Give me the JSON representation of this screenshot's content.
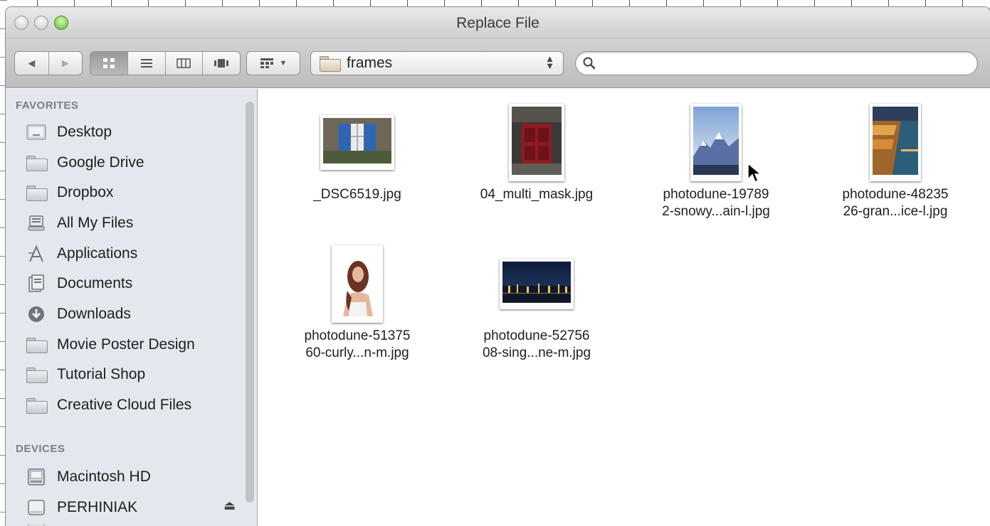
{
  "window": {
    "title": "Replace File"
  },
  "toolbar": {
    "back_icon": "◀",
    "forward_icon": "▶",
    "view_modes": [
      "icon-view",
      "list-view",
      "column-view",
      "cover-flow-view"
    ],
    "active_view": "icon-view",
    "arrange_icon": "arrange-icon",
    "path_folder": "frames",
    "search_placeholder": ""
  },
  "sidebar": {
    "favorites_header": "FAVORITES",
    "favorites": [
      {
        "label": "Desktop",
        "icon": "desktop-icon"
      },
      {
        "label": "Google Drive",
        "icon": "folder-icon"
      },
      {
        "label": "Dropbox",
        "icon": "folder-icon"
      },
      {
        "label": "All My Files",
        "icon": "all-files-icon"
      },
      {
        "label": "Applications",
        "icon": "applications-icon"
      },
      {
        "label": "Documents",
        "icon": "documents-icon"
      },
      {
        "label": "Downloads",
        "icon": "downloads-icon"
      },
      {
        "label": "Movie Poster Design",
        "icon": "folder-icon"
      },
      {
        "label": "Tutorial Shop",
        "icon": "folder-icon"
      },
      {
        "label": "Creative Cloud Files",
        "icon": "folder-icon"
      }
    ],
    "devices_header": "DEVICES",
    "devices": [
      {
        "label": "Macintosh HD",
        "icon": "hard-drive-icon",
        "eject": false
      },
      {
        "label": "PERHINIAK",
        "icon": "external-drive-icon",
        "eject": true
      }
    ]
  },
  "files": [
    {
      "line1": "_DSC6519.jpg",
      "line2": "",
      "kind": "window-photo"
    },
    {
      "line1": "04_multi_mask.jpg",
      "line2": "",
      "kind": "red-door-photo"
    },
    {
      "line1": "photodune-19789",
      "line2": "2-snowy...ain-l.jpg",
      "kind": "snowy-mountain-photo"
    },
    {
      "line1": "photodune-48235",
      "line2": "26-gran...ice-l.jpg",
      "kind": "grand-canal-photo"
    },
    {
      "line1": "photodune-51375",
      "line2": "60-curly...n-m.jpg",
      "kind": "curly-woman-photo"
    },
    {
      "line1": "photodune-52756",
      "line2": "08-sing...ne-m.jpg",
      "kind": "night-skyline-photo"
    }
  ]
}
